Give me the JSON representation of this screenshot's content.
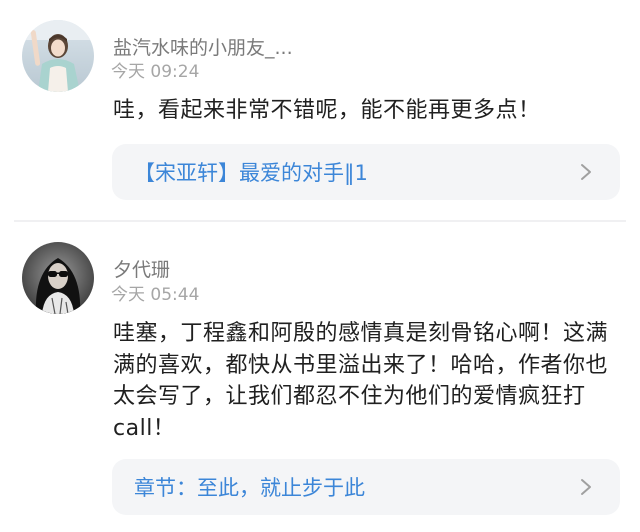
{
  "comments": [
    {
      "username": "盐汽水味的小朋友_...",
      "time": "今天 09:24",
      "text": "哇，看起来非常不错呢，能不能再更多点！",
      "link_text": "【宋亚轩】最爱的对手‖1",
      "avatar_icon": "avatar-girl-photo"
    },
    {
      "username": "夕代珊",
      "time": "今天 05:44",
      "text": "哇塞，丁程鑫和阿殷的感情真是刻骨铭心啊！这满满的喜欢，都快从书里溢出来了！哈哈，作者你也太会写了，让我们都忍不住为他们的爱情疯狂打call！",
      "link_text": "章节：至此，就止步于此",
      "avatar_icon": "avatar-sunglasses-photo"
    }
  ],
  "colors": {
    "link": "#3c86d8",
    "username": "#7a7a7a",
    "time": "#a6a6a6",
    "body": "#202020",
    "link_box_bg": "#f4f5f7"
  }
}
